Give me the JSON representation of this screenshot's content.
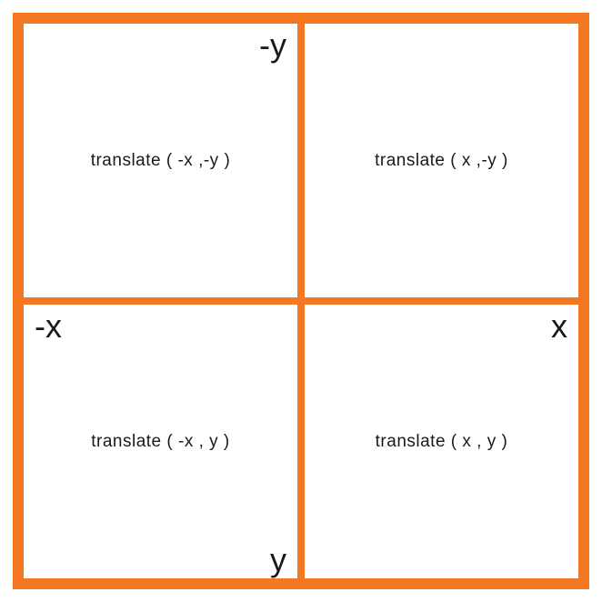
{
  "grid": {
    "border_color": "#F47721",
    "cells": {
      "q2": {
        "label": "translate ( -x ,-y )",
        "axis": "-y"
      },
      "q1": {
        "label": "translate ( x ,-y )",
        "axis": ""
      },
      "q3": {
        "label": "translate ( -x , y )",
        "axis_left": "-x",
        "axis_bottom": "y"
      },
      "q4": {
        "label": "translate ( x , y )",
        "axis_right": "x"
      }
    }
  }
}
